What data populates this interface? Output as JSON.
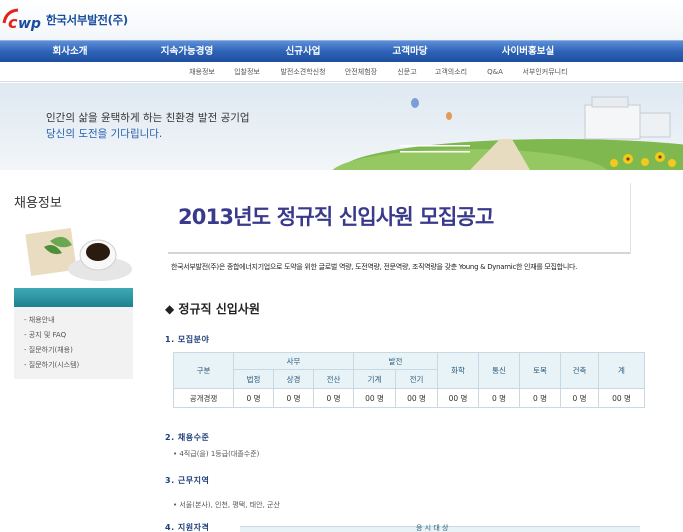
{
  "header": {
    "logo_text": "한국서부발전(주)",
    "gnb": [
      "회사소개",
      "지속가능경영",
      "신규사업",
      "고객마당",
      "사이버홍보실"
    ],
    "snb": [
      "채용정보",
      "입찰정보",
      "발전소견학신청",
      "안전체험장",
      "신문고",
      "고객의소리",
      "Q&A",
      "서부인커뮤니티"
    ]
  },
  "visual": {
    "line1": "인간의 삶을 윤택하게 하는 친환경 발전 공기업",
    "line2": "당신의 도전을 기다립니다."
  },
  "sidebar": {
    "title": "채용정보",
    "menu": [
      "- 채용안내",
      "- 공지 및 FAQ",
      "- 질문하기(채용)",
      "- 질문하기(시스템)"
    ]
  },
  "content": {
    "page_title": "2013년도 정규직 신입사원 모집공고",
    "intro": "한국서부발전(주)은 종합에너지기업으로 도약을 위한 글로벌 역량, 도전역량, 전문역량, 조직역량을 갖춘 Young & Dynamic한 인재를 모집합니다.",
    "section_title": "◆ 정규직 신입사원",
    "sections": [
      {
        "heading": "1. 모집분야"
      },
      {
        "heading": "2. 채용수준",
        "bullet": "• 4직급(을) 1등급(대졸수준)"
      },
      {
        "heading": "3. 근무지역",
        "bullet": "• 서울(본사), 인천, 평택, 태안, 군산"
      },
      {
        "heading": "4. 지원자격"
      }
    ],
    "table": {
      "header_category": "구분",
      "group_office": "사무",
      "group_power": "발전",
      "columns_office": [
        "법정",
        "상경",
        "전산"
      ],
      "columns_power": [
        "기계",
        "전기"
      ],
      "columns_single": [
        "화학",
        "통신",
        "토목",
        "건축",
        "계"
      ],
      "row_label": "공개경쟁",
      "row_values": [
        "0 명",
        "0 명",
        "0 명",
        "00 명",
        "00 명",
        "00 명",
        "0 명",
        "0 명",
        "0 명",
        "00 명"
      ]
    },
    "partial_label": "응 시 대 상"
  },
  "colors": {
    "gnb_blue": "#2e63b8",
    "sidebar_teal": "#1d8190",
    "title_navy": "#3a3a8c",
    "logo_red": "#e2231a"
  }
}
